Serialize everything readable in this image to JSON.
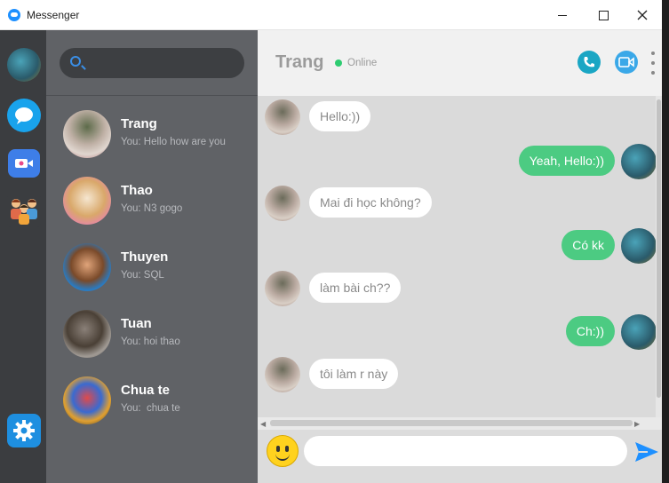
{
  "window": {
    "title": "Messenger"
  },
  "search": {
    "placeholder": ""
  },
  "contacts": [
    {
      "name": "Trang",
      "last": "You: Hello how are you"
    },
    {
      "name": "Thao",
      "last": "You: N3 gogo"
    },
    {
      "name": "Thuyen",
      "last": "You: SQL"
    },
    {
      "name": "Tuan",
      "last": "You: hoi thao"
    },
    {
      "name": "Chua te",
      "last": "You:  chua te"
    }
  ],
  "chat": {
    "name": "Trang",
    "status": "Online",
    "messages": [
      {
        "from": "them",
        "text": "Hello:))"
      },
      {
        "from": "me",
        "text": "Yeah, Hello:))"
      },
      {
        "from": "them",
        "text": "Mai đi học không?"
      },
      {
        "from": "me",
        "text": "Có kk"
      },
      {
        "from": "them",
        "text": "làm bài ch??"
      },
      {
        "from": "me",
        "text": "Ch:))"
      },
      {
        "from": "them",
        "text": "tôi làm r này"
      }
    ]
  },
  "composer": {
    "value": ""
  },
  "colors": {
    "sent_bubble": "#4ccb82",
    "received_bubble": "#ffffff",
    "online": "#2ecc71",
    "accent": "#1e8fe0"
  },
  "icons": [
    "app-icon",
    "search-icon",
    "chat-icon",
    "video-call-icon",
    "group-icon",
    "settings-icon",
    "phone-icon",
    "video-icon",
    "more-icon",
    "emoji-icon",
    "send-icon"
  ]
}
